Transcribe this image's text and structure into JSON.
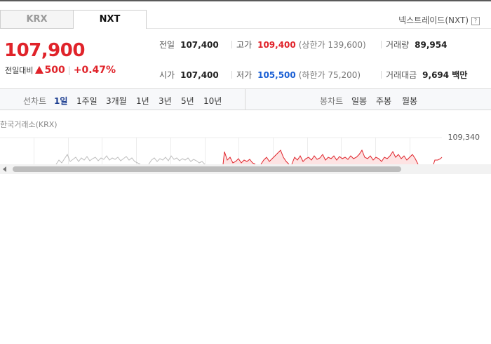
{
  "tabs": [
    {
      "label": "KRX",
      "selected": false
    },
    {
      "label": "NXT",
      "selected": true
    }
  ],
  "exchange_label": "넥스트레이드(NXT)",
  "help_icon_text": "?",
  "price": {
    "current": "107,900",
    "change_label": "전일대비",
    "change_value": "500",
    "change_pct": "+0.47%",
    "direction": "up",
    "color": "#e0232a"
  },
  "stats": {
    "prev_close": {
      "label": "전일",
      "value": "107,400"
    },
    "high": {
      "label": "고가",
      "value": "109,400",
      "sub": "(상한가 139,600)"
    },
    "volume": {
      "label": "거래량",
      "value": "89,954"
    },
    "open": {
      "label": "시가",
      "value": "107,400"
    },
    "low": {
      "label": "저가",
      "value": "105,500",
      "sub": "(하한가 75,200)"
    },
    "amount": {
      "label": "거래대금",
      "value": "9,694 백만"
    }
  },
  "chart_nav": {
    "line_label": "선차트",
    "line_periods": [
      "1일",
      "1주일",
      "3개월",
      "1년",
      "3년",
      "5년",
      "10년"
    ],
    "active_period": "1일",
    "candle_label": "봉차트",
    "candle_periods": [
      "일봉",
      "주봉",
      "월봉"
    ]
  },
  "chart": {
    "source": "한국거래소(KRX)",
    "y_label": "109,340"
  },
  "colors": {
    "up": "#e0232a",
    "down": "#1a5fd4",
    "active_nav": "#1a3c8f"
  }
}
